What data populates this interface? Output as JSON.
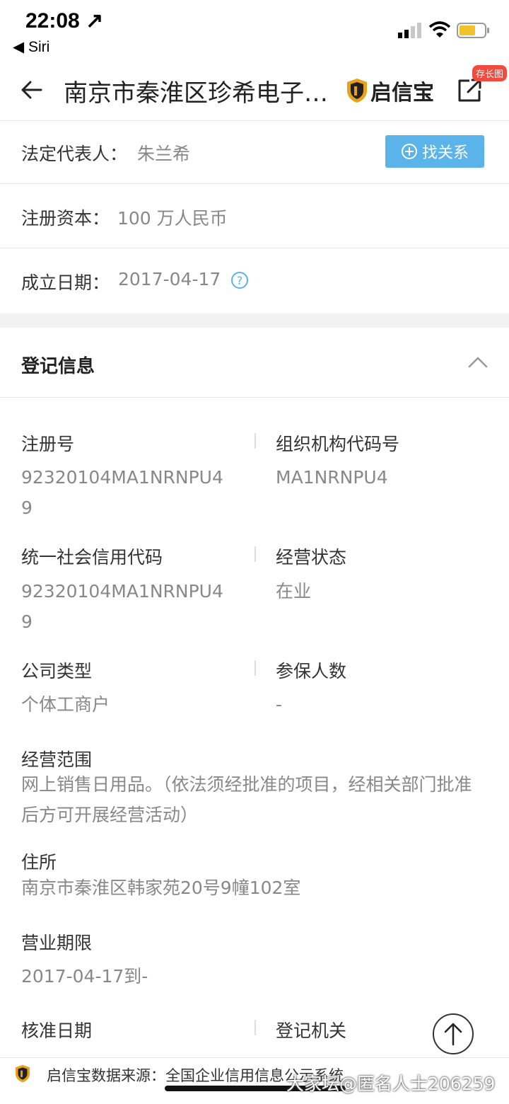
{
  "status_bar": {
    "time": "22:08 ↗",
    "back_app": "◀ Siri"
  },
  "header": {
    "title": "南京市秦淮区珍希电子…",
    "brand_name": "启信宝",
    "badge": "存长图"
  },
  "summary": {
    "legal_rep_label": "法定代表人：",
    "legal_rep_value": "朱兰希",
    "relation_button": "找关系",
    "capital_label": "注册资本：",
    "capital_value": "100 万人民币",
    "founded_label": "成立日期：",
    "founded_value": "2017-04-17",
    "help_glyph": "?"
  },
  "registration": {
    "title": "登记信息",
    "reg_no_label": "注册号",
    "reg_no_value": "92320104MA1NRNPU4\n9",
    "org_code_label": "组织机构代码号",
    "org_code_value": "MA1NRNPU4",
    "credit_code_label": "统一社会信用代码",
    "credit_code_value": "92320104MA1NRNPU4\n9",
    "status_label": "经营状态",
    "status_value": "在业",
    "company_type_label": "公司类型",
    "company_type_value": "个体工商户",
    "insured_label": "参保人数",
    "insured_value": "-",
    "scope_label": "经营范围",
    "scope_value": "网上销售日用品。（依法须经批准的项目，经相关部门批准后方可开展经营活动）",
    "address_label": "住所",
    "address_value": "南京市秦淮区韩家苑20号9幢102室",
    "term_label": "营业期限",
    "term_value": "2017-04-17到-",
    "approval_label": "核准日期",
    "authority_label": "登记机关"
  },
  "footer": {
    "source_text": "启信宝数据来源：全国企业信用信息公示系统",
    "watermark": "大家坛@匿名人士206259"
  },
  "colors": {
    "accent": "#5ab4ea",
    "badge": "#f04b3c",
    "logo_gold": "#e8a21a"
  }
}
